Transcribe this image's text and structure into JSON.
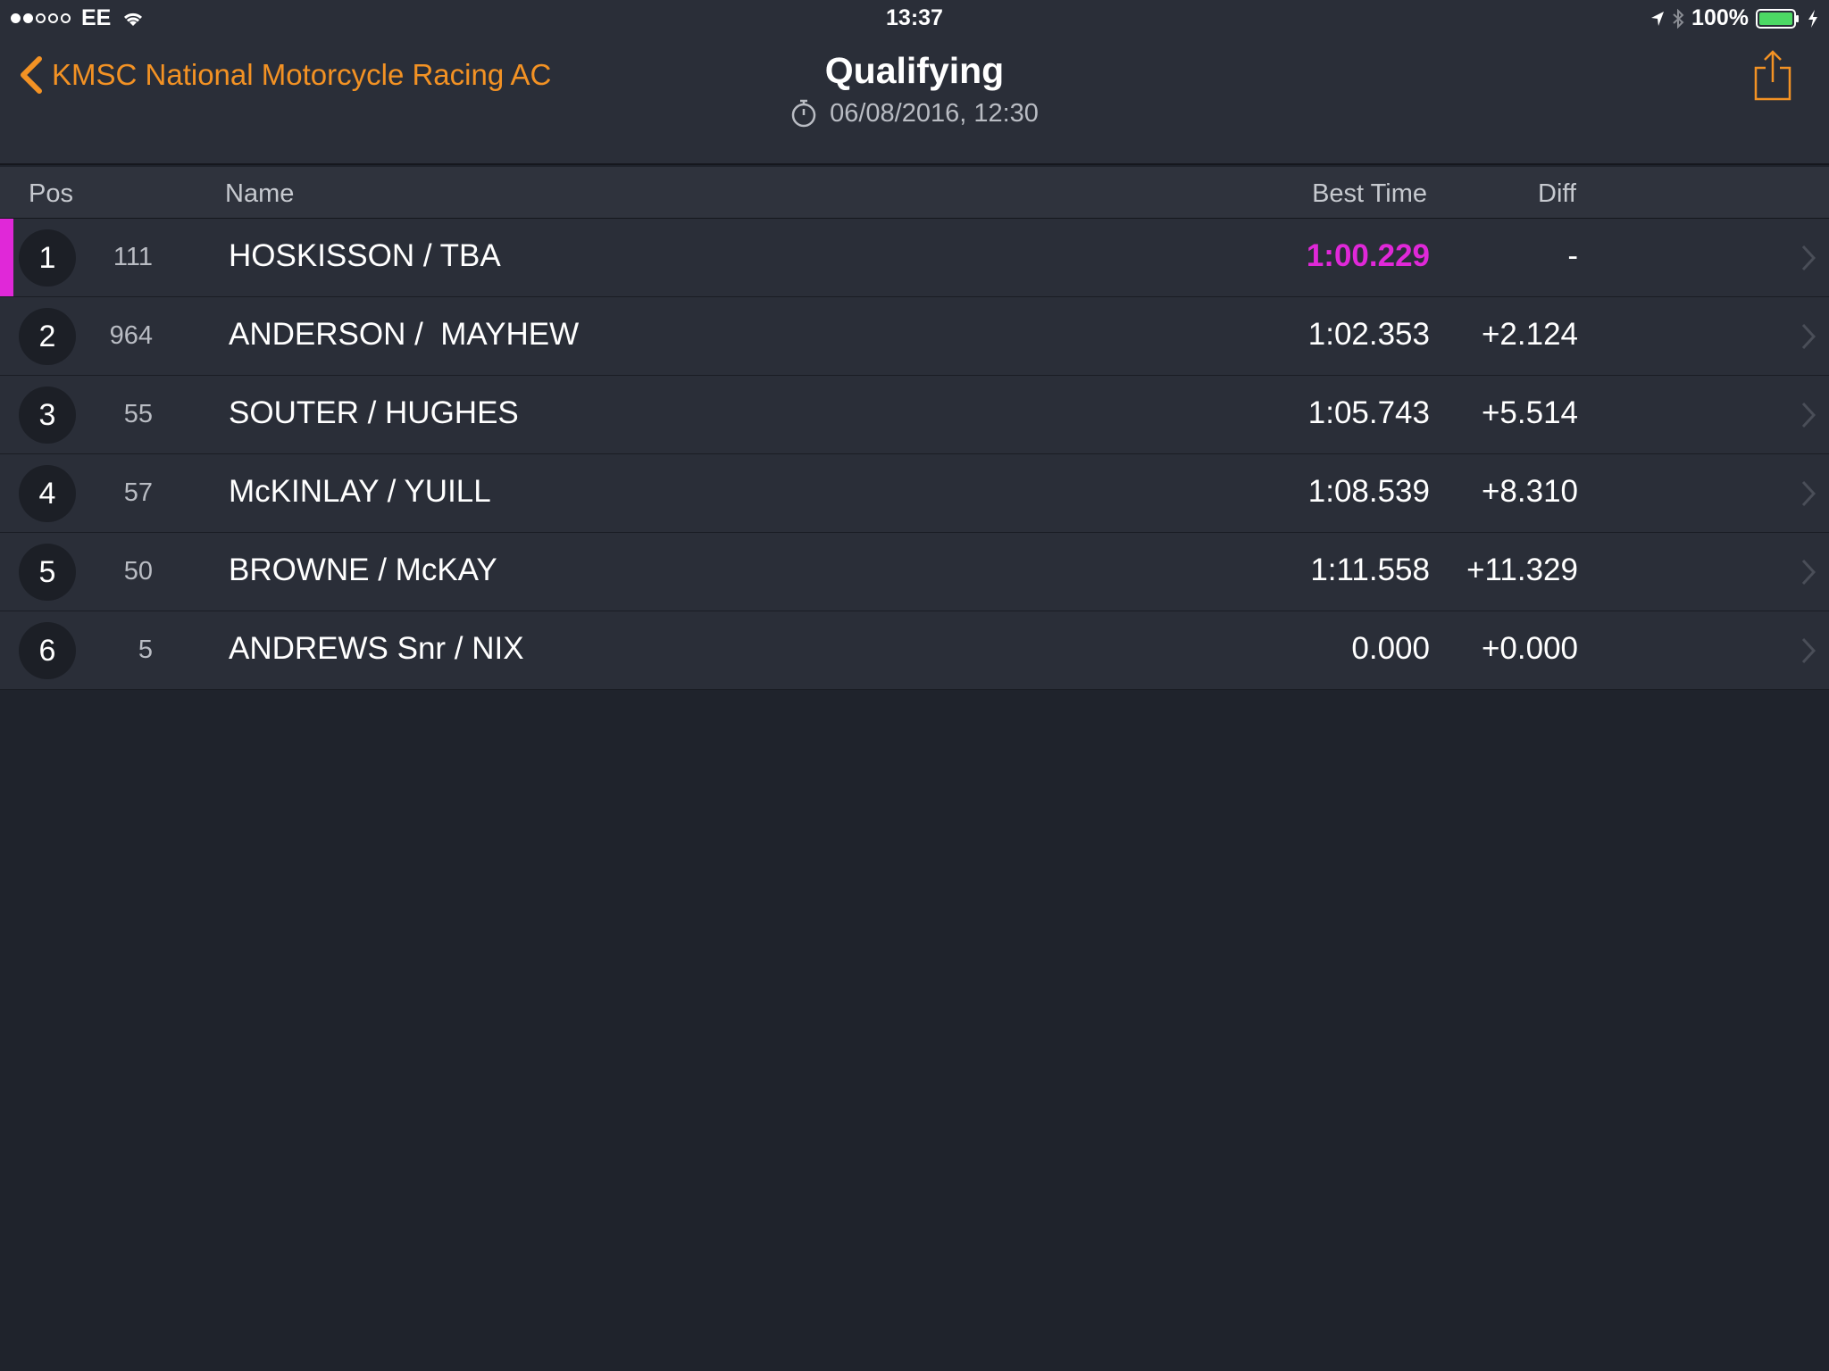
{
  "status_bar": {
    "carrier": "EE",
    "time": "13:37",
    "battery": "100%"
  },
  "nav": {
    "back_label": "KMSC National Motorcycle Racing AC",
    "title": "Qualifying",
    "subtitle": "06/08/2016, 12:30"
  },
  "table": {
    "headers": {
      "pos": "Pos",
      "name": "Name",
      "best": "Best Time",
      "diff": "Diff"
    },
    "rows": [
      {
        "pos": "1",
        "num": "111",
        "name": "HOSKISSON / TBA",
        "best": "1:00.229",
        "diff": "-",
        "fastest": true
      },
      {
        "pos": "2",
        "num": "964",
        "name": "ANDERSON /  MAYHEW",
        "best": "1:02.353",
        "diff": "+2.124"
      },
      {
        "pos": "3",
        "num": "55",
        "name": "SOUTER / HUGHES",
        "best": "1:05.743",
        "diff": "+5.514"
      },
      {
        "pos": "4",
        "num": "57",
        "name": "McKINLAY / YUILL",
        "best": "1:08.539",
        "diff": "+8.310"
      },
      {
        "pos": "5",
        "num": "50",
        "name": "BROWNE / McKAY",
        "best": "1:11.558",
        "diff": "+11.329"
      },
      {
        "pos": "6",
        "num": "5",
        "name": "ANDREWS Snr / NIX",
        "best": "0.000",
        "diff": "+0.000"
      }
    ]
  },
  "colors": {
    "accent": "#f39224",
    "fastest": "#e028d8",
    "background": "#1f232c",
    "row": "#2a2e38"
  }
}
